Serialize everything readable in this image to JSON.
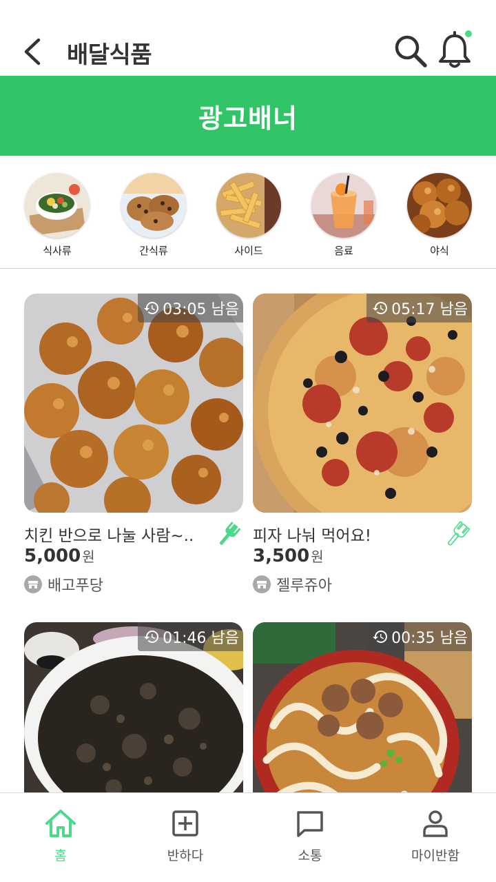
{
  "header": {
    "title": "배달식품",
    "back_icon": "chevron-left-icon",
    "search_icon": "search-icon",
    "notification_icon": "bell-icon",
    "notification_dot_color": "#4dd98a"
  },
  "banner": {
    "label": "광고배너",
    "color": "#30c467"
  },
  "categories": [
    {
      "label": "식사류",
      "icon": "meal-image"
    },
    {
      "label": "간식류",
      "icon": "snack-image"
    },
    {
      "label": "사이드",
      "icon": "side-image"
    },
    {
      "label": "음료",
      "icon": "drink-image"
    },
    {
      "label": "야식",
      "icon": "night-snack-image"
    }
  ],
  "posts": [
    {
      "title": "치킨 반으로 나눌 사람~..",
      "price": "5,000",
      "unit": "원",
      "store": "배고푸당",
      "timer": "03:05 남음",
      "image": "fried-chicken-photo",
      "fork_active": true
    },
    {
      "title": "피자 나눠 먹어요!",
      "price": "3,500",
      "unit": "원",
      "store": "젤루쥬아",
      "timer": "05:17 남음",
      "image": "pizza-photo",
      "fork_active": false
    },
    {
      "title": "",
      "price": "",
      "unit": "",
      "store": "",
      "timer": "01:46 남음",
      "image": "jjajangmyeon-photo",
      "fork_active": false
    },
    {
      "title": "",
      "price": "",
      "unit": "",
      "store": "",
      "timer": "00:35 남음",
      "image": "udon-photo",
      "fork_active": false
    }
  ],
  "bottom_nav": [
    {
      "label": "홈",
      "icon": "home-icon",
      "active": true
    },
    {
      "label": "반하다",
      "icon": "plus-square-icon",
      "active": false
    },
    {
      "label": "소통",
      "icon": "chat-icon",
      "active": false
    },
    {
      "label": "마이반함",
      "icon": "user-icon",
      "active": false
    }
  ],
  "colors": {
    "accent": "#30c467",
    "active_nav": "#4dd98a"
  }
}
